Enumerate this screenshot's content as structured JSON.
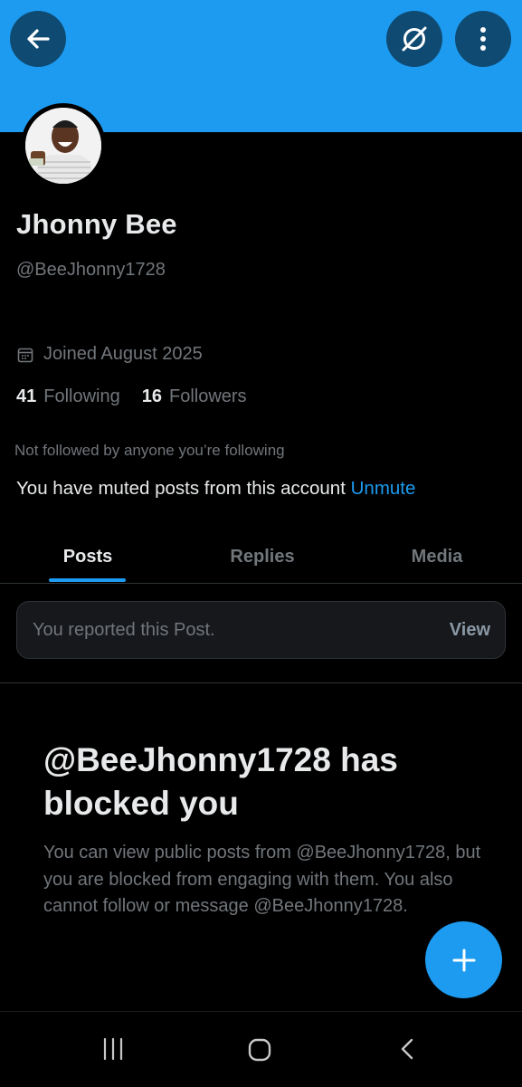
{
  "header": {
    "back_icon": "arrow-left-icon",
    "grok_icon": "slashed-circle-icon",
    "more_icon": "more-vertical-icon",
    "banner_color": "#1d9bf0"
  },
  "profile": {
    "display_name": "Jhonny Bee",
    "handle": "@BeeJhonny1728",
    "joined": "Joined August 2025",
    "following_count": "41",
    "following_label": "Following",
    "followers_count": "16",
    "followers_label": "Followers",
    "not_followed": "Not followed by anyone you’re following",
    "muted_text": "You have muted posts from this account",
    "unmute_label": "Unmute"
  },
  "tabs": [
    {
      "label": "Posts",
      "active": true
    },
    {
      "label": "Replies",
      "active": false
    },
    {
      "label": "Media",
      "active": false
    }
  ],
  "report": {
    "text": "You reported this Post.",
    "view_label": "View"
  },
  "blocked": {
    "title": "@BeeJhonny1728 has blocked you",
    "body": "You can view public posts from @BeeJhonny1728, but you are blocked from engaging with them. You also cannot follow or message @BeeJhonny1728."
  },
  "fab": {
    "icon": "plus-icon",
    "color": "#1d9bf0"
  },
  "navbar": {
    "icons": [
      "recent-apps-icon",
      "home-icon",
      "back-icon"
    ]
  }
}
